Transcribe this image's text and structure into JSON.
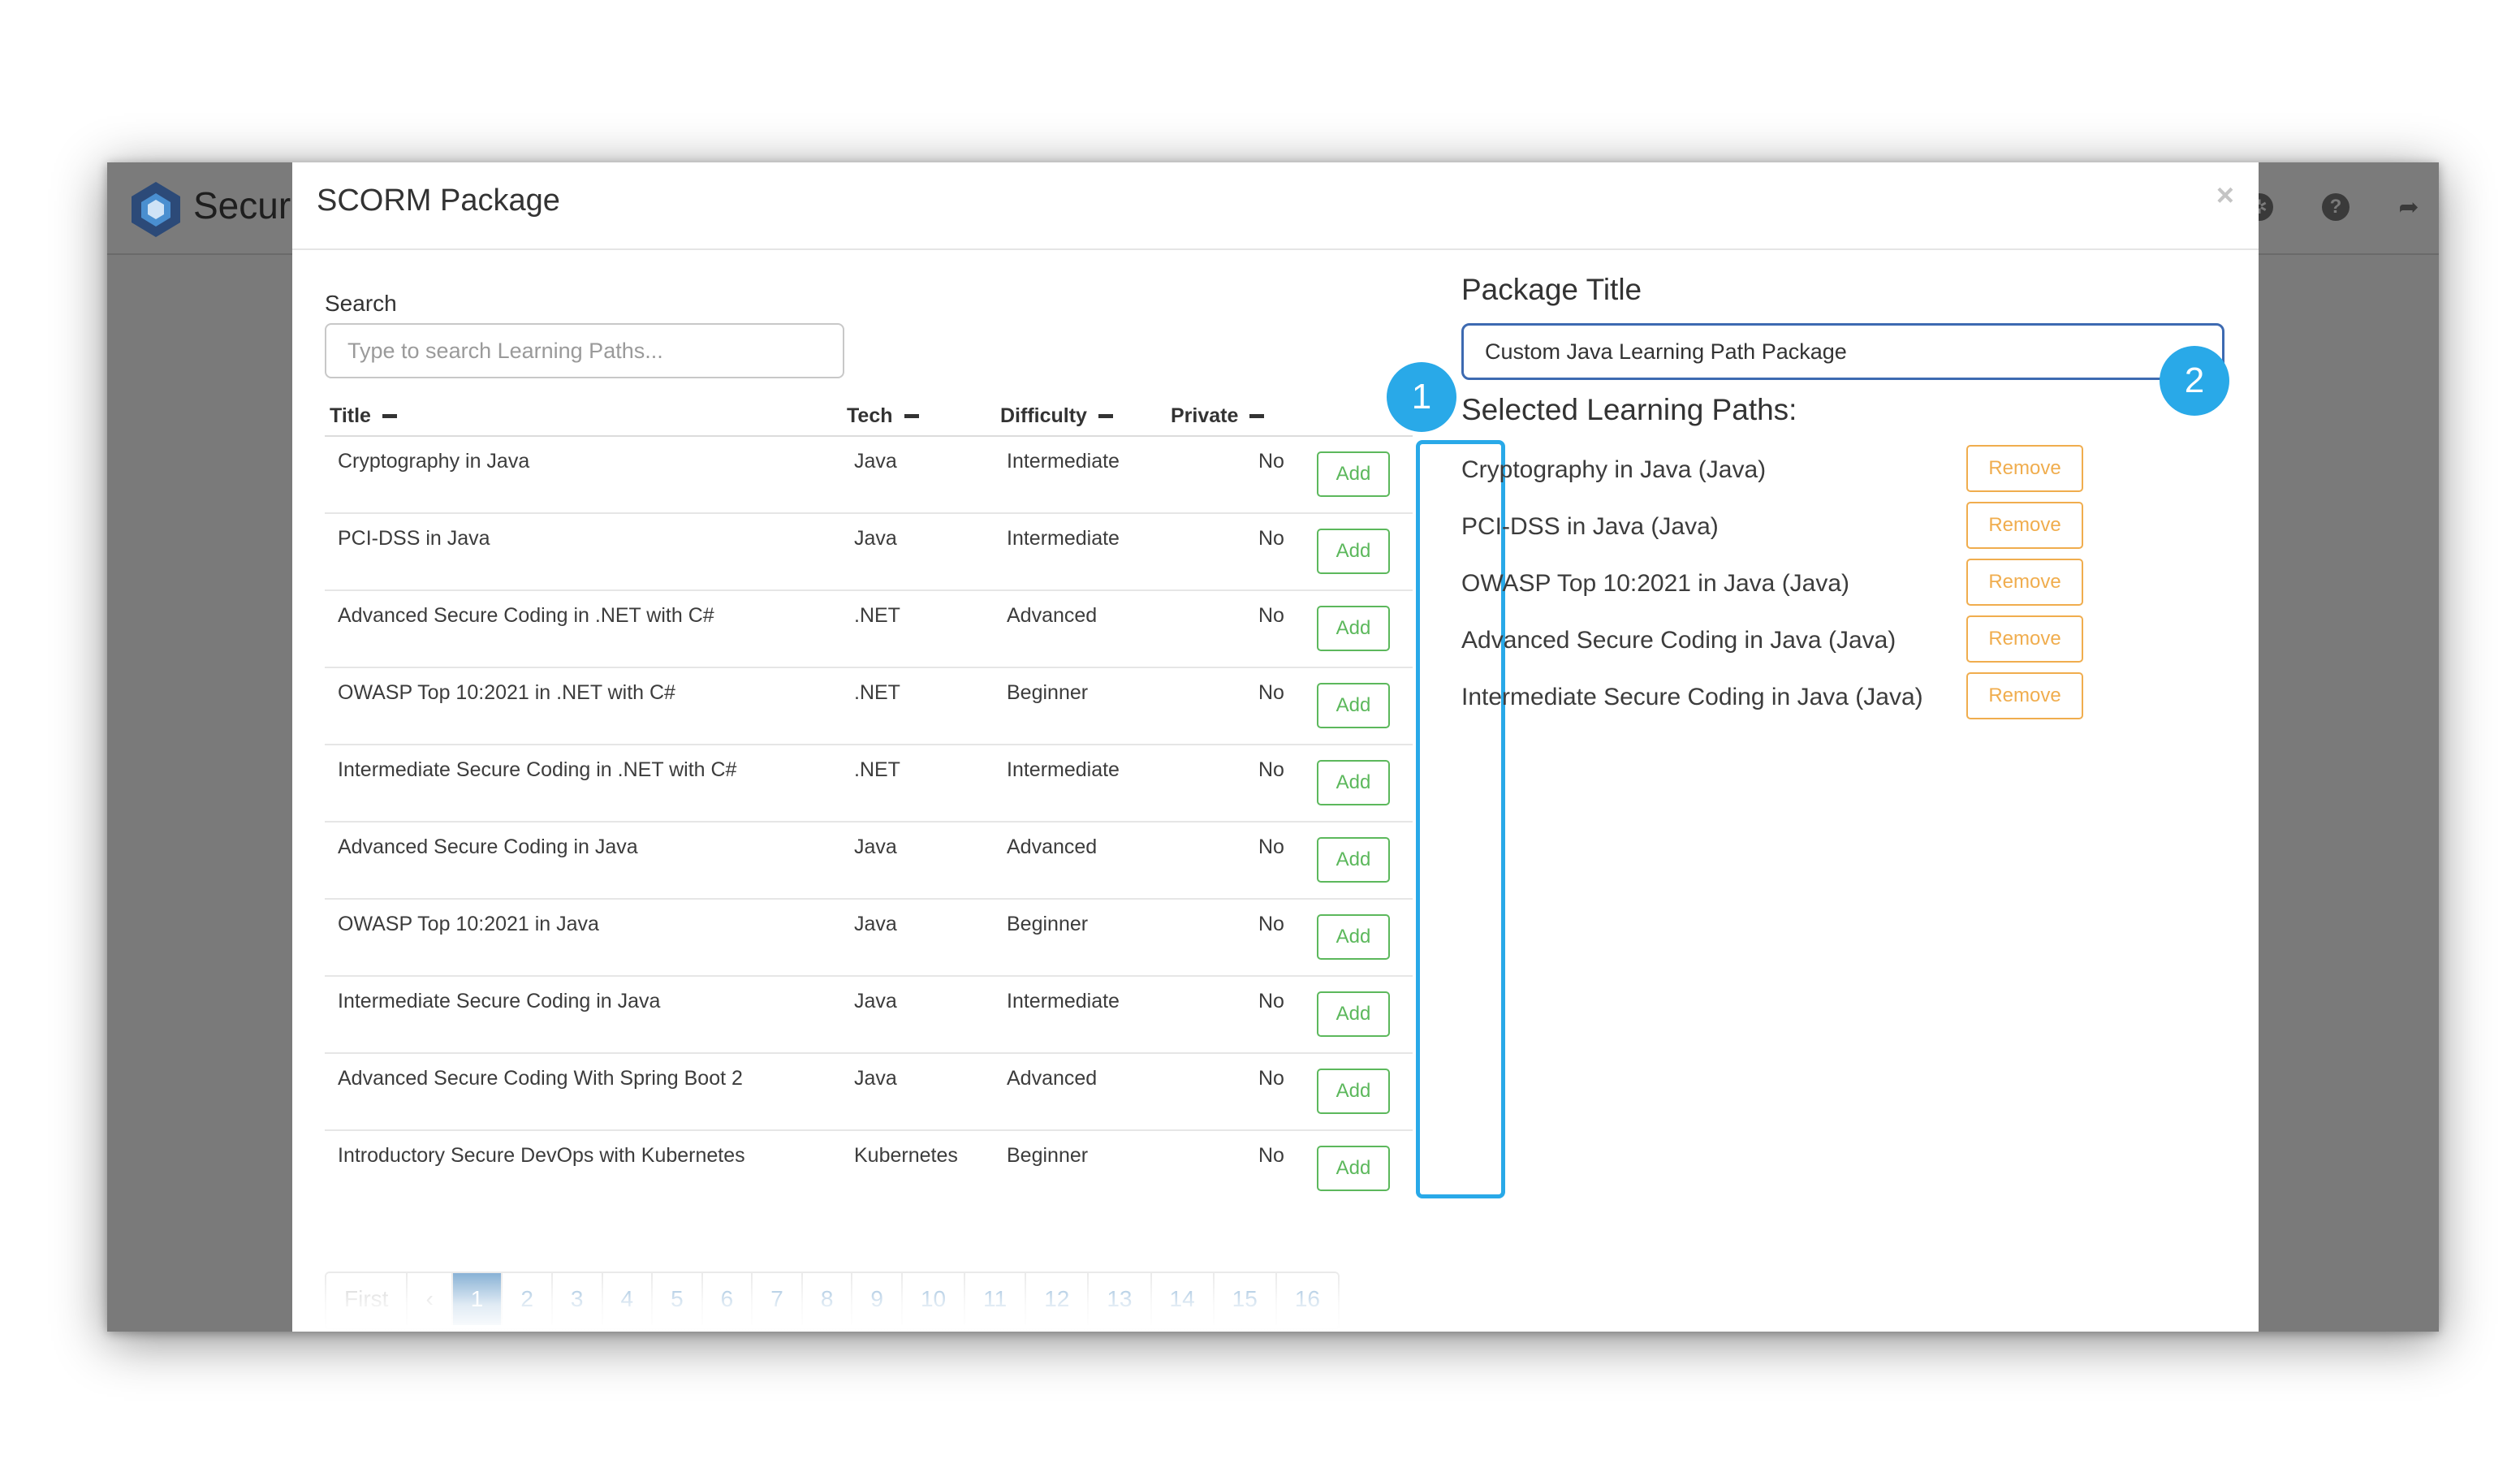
{
  "app": {
    "brand": "Secur",
    "header_icons": [
      "settings-icon",
      "help-icon",
      "logout-icon"
    ]
  },
  "modal": {
    "title": "SCORM Package",
    "close_symbol": "×"
  },
  "search": {
    "label": "Search",
    "placeholder": "Type to search Learning Paths..."
  },
  "table": {
    "columns": [
      "Title",
      "Tech",
      "Difficulty",
      "Private"
    ],
    "add_label": "Add",
    "rows": [
      {
        "title": "Cryptography in Java",
        "tech": "Java",
        "difficulty": "Intermediate",
        "private": "No"
      },
      {
        "title": "PCI-DSS in Java",
        "tech": "Java",
        "difficulty": "Intermediate",
        "private": "No"
      },
      {
        "title": "Advanced Secure Coding in .NET with C#",
        "tech": ".NET",
        "difficulty": "Advanced",
        "private": "No"
      },
      {
        "title": "OWASP Top 10:2021 in .NET with C#",
        "tech": ".NET",
        "difficulty": "Beginner",
        "private": "No"
      },
      {
        "title": "Intermediate Secure Coding in .NET with C#",
        "tech": ".NET",
        "difficulty": "Intermediate",
        "private": "No"
      },
      {
        "title": "Advanced Secure Coding in Java",
        "tech": "Java",
        "difficulty": "Advanced",
        "private": "No"
      },
      {
        "title": "OWASP Top 10:2021 in Java",
        "tech": "Java",
        "difficulty": "Beginner",
        "private": "No"
      },
      {
        "title": "Intermediate Secure Coding in Java",
        "tech": "Java",
        "difficulty": "Intermediate",
        "private": "No"
      },
      {
        "title": "Advanced Secure Coding With Spring Boot 2",
        "tech": "Java",
        "difficulty": "Advanced",
        "private": "No"
      },
      {
        "title": "Introductory Secure DevOps with Kubernetes",
        "tech": "Kubernetes",
        "difficulty": "Beginner",
        "private": "No"
      }
    ]
  },
  "pagination": {
    "first_label": "First",
    "prev_label": "‹",
    "pages": [
      "1",
      "2",
      "3",
      "4",
      "5",
      "6",
      "7",
      "8",
      "9",
      "10",
      "11",
      "12",
      "13",
      "14",
      "15",
      "16"
    ],
    "active_page": "1"
  },
  "package": {
    "title_label": "Package Title",
    "title_value": "Custom Java Learning Path Package",
    "selected_label": "Selected Learning Paths:",
    "remove_label": "Remove",
    "selected": [
      "Cryptography in Java (Java)",
      "PCI-DSS in Java (Java)",
      "OWASP Top 10:2021 in Java (Java)",
      "Advanced Secure Coding in Java (Java)",
      "Intermediate Secure Coding in Java (Java)"
    ]
  },
  "callouts": [
    "1",
    "2"
  ],
  "colors": {
    "accent_blue": "#29a9e8",
    "add_green": "#5cb85c",
    "remove_orange": "#f0ad4e",
    "page_active": "#337ab7"
  }
}
